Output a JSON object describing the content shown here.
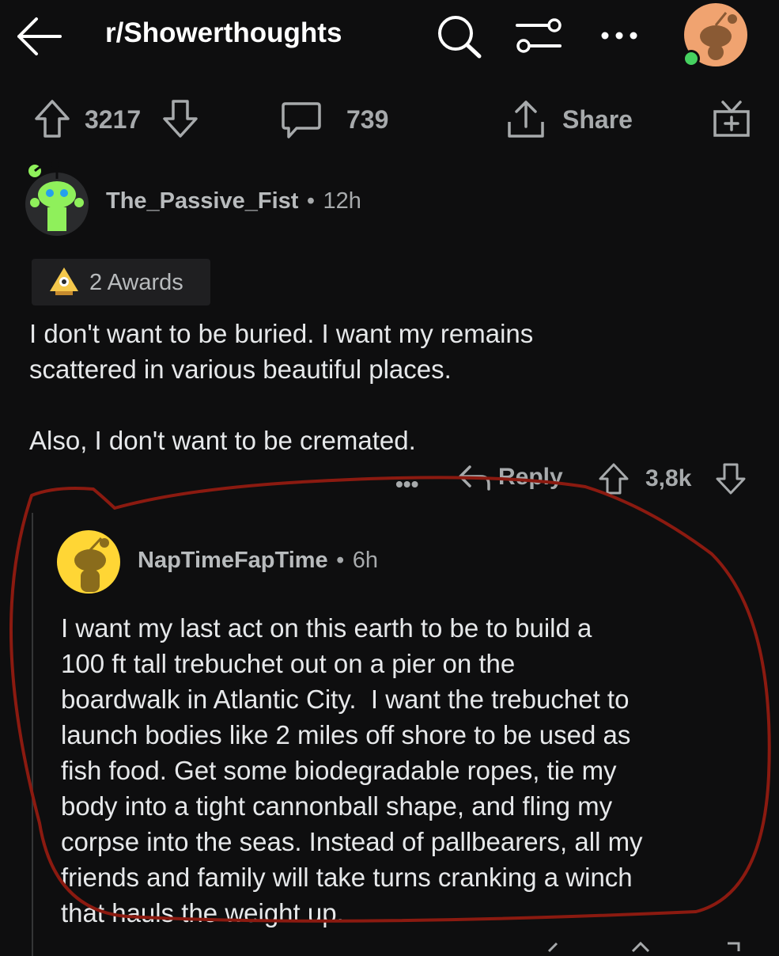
{
  "header": {
    "subreddit": "r/Showerthoughts",
    "back_icon": "back-arrow-icon",
    "search_icon": "search-icon",
    "filter_icon": "sliders-icon",
    "more_icon": "more-horizontal-icon",
    "avatar_status": "online"
  },
  "post_actions": {
    "upvotes": "3217",
    "comments": "739",
    "share_label": "Share",
    "award_icon": "gift-plus-icon"
  },
  "comment1": {
    "username": "The_Passive_Fist",
    "separator": "•",
    "time": "12h",
    "awards": "2 Awards",
    "text": "I don't want to be buried. I want my remains\nscattered in various beautiful places.\n\nAlso, I don't want to be cremated.",
    "reply_label": "Reply",
    "score": "3,8k",
    "avatar_color": "#8ff05b"
  },
  "comment2": {
    "username": "NapTimeFapTime",
    "separator": "•",
    "time": "6h",
    "text": "I want my last act on this earth to be to build a\n100 ft tall trebuchet out on a pier on the\nboardwalk in Atlantic City.  I want the trebuchet to\nlaunch bodies like 2 miles off shore to be used as\nfish food. Get some biodegradable ropes, tie my\nbody into a tight cannonball shape, and fling my\ncorpse into the seas. Instead of pallbearers, all my\nfriends and family will take turns cranking a winch\nthat hauls the weight up.",
    "avatar_color": "#ffd635"
  },
  "colors": {
    "background": "#0e0e0f",
    "annotation": "#8b1a10",
    "online": "#46d160"
  }
}
